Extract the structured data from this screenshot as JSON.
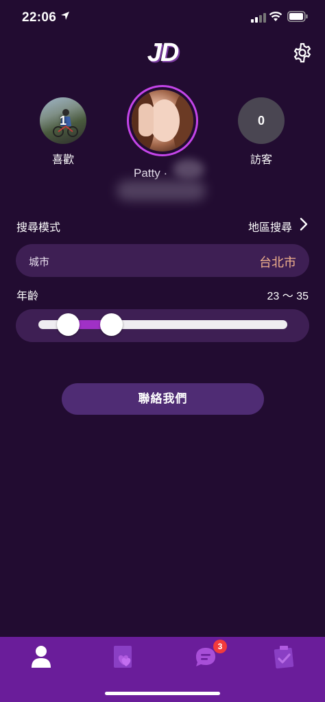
{
  "status_bar": {
    "time": "22:06"
  },
  "header": {
    "logo": "JD"
  },
  "likes": {
    "count": "1",
    "label": "喜歡"
  },
  "visitors": {
    "count": "0",
    "label": "訪客"
  },
  "profile": {
    "name": "Patty ·"
  },
  "search": {
    "mode_label": "搜尋模式",
    "mode_value": "地區搜尋",
    "city_label": "城市",
    "city_value": "台北市"
  },
  "age": {
    "label": "年齡",
    "range_text": "23 ～ 35",
    "min": 23,
    "max": 35,
    "slider_min": 18,
    "slider_max": 80
  },
  "contact": {
    "label": "聯絡我們"
  },
  "tabs": {
    "chat_badge": "3",
    "items": [
      {
        "icon": "person-icon",
        "active": true
      },
      {
        "icon": "heart-card-icon",
        "active": false
      },
      {
        "icon": "chat-bubble-icon",
        "active": false
      },
      {
        "icon": "checklist-icon",
        "active": false
      }
    ]
  },
  "colors": {
    "background": "#220c31",
    "pill": "#3e1f54",
    "accent": "#a031c6",
    "tab_bar": "#6a1d9a",
    "city_value": "#f2b28d",
    "badge": "#f23b3b"
  }
}
